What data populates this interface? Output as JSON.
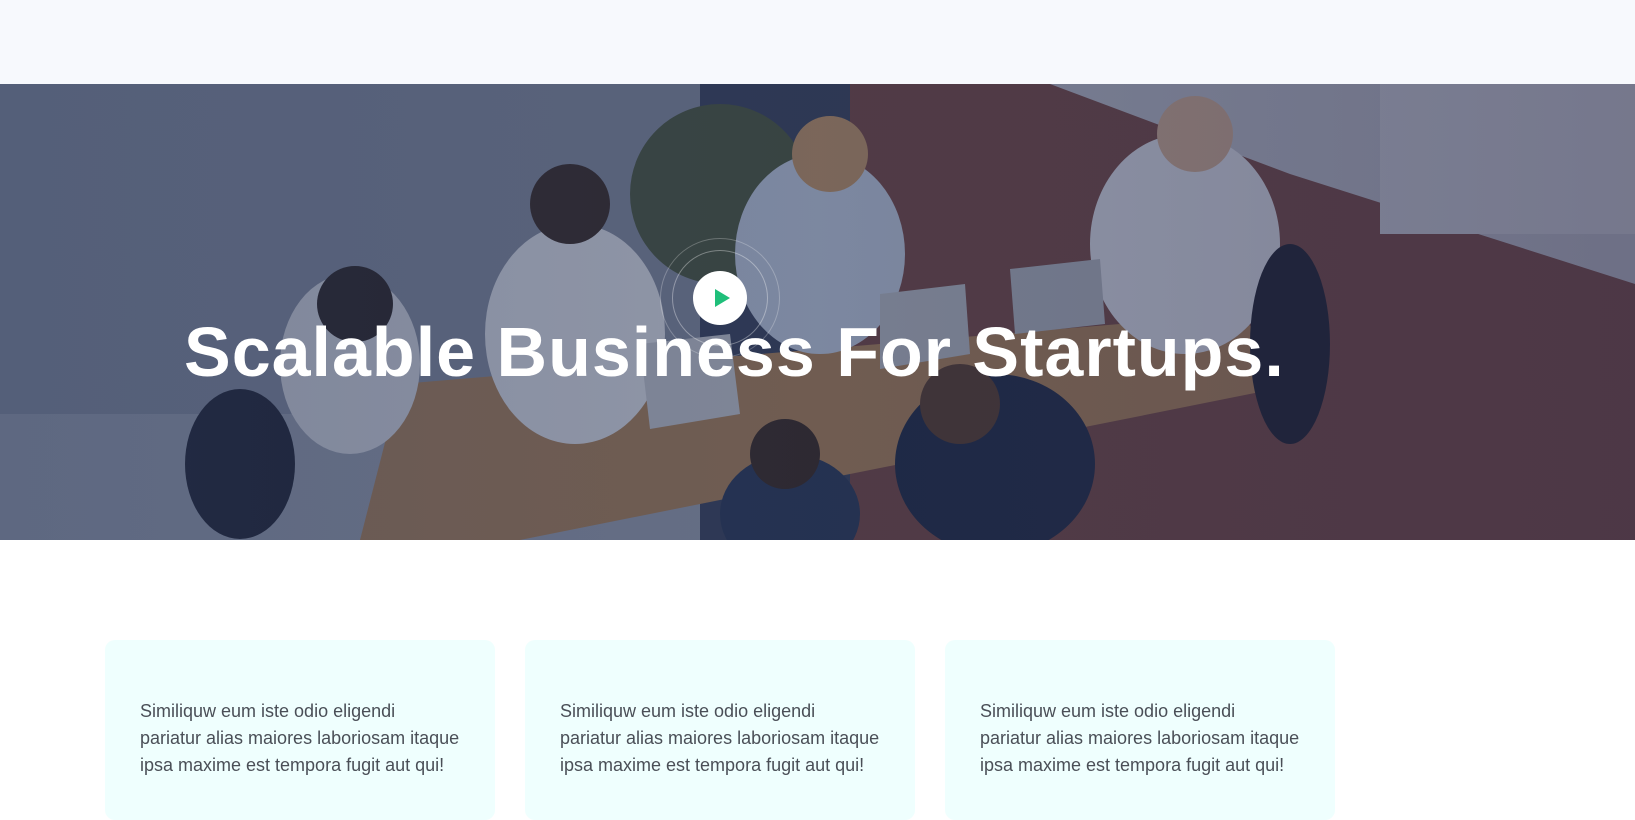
{
  "hero": {
    "title": "Scalable Business For Startups.",
    "play_icon": "play-icon",
    "accent_color": "#1fbf7a"
  },
  "cards": [
    {
      "text": "Similiquw eum iste odio eligendi pariatur alias maiores laboriosam itaque ipsa maxime est tempora fugit aut qui!"
    },
    {
      "text": "Similiquw eum iste odio eligendi pariatur alias maiores laboriosam itaque ipsa maxime est tempora fugit aut qui!"
    },
    {
      "text": "Similiquw eum iste odio eligendi pariatur alias maiores laboriosam itaque ipsa maxime est tempora fugit aut qui!"
    }
  ]
}
